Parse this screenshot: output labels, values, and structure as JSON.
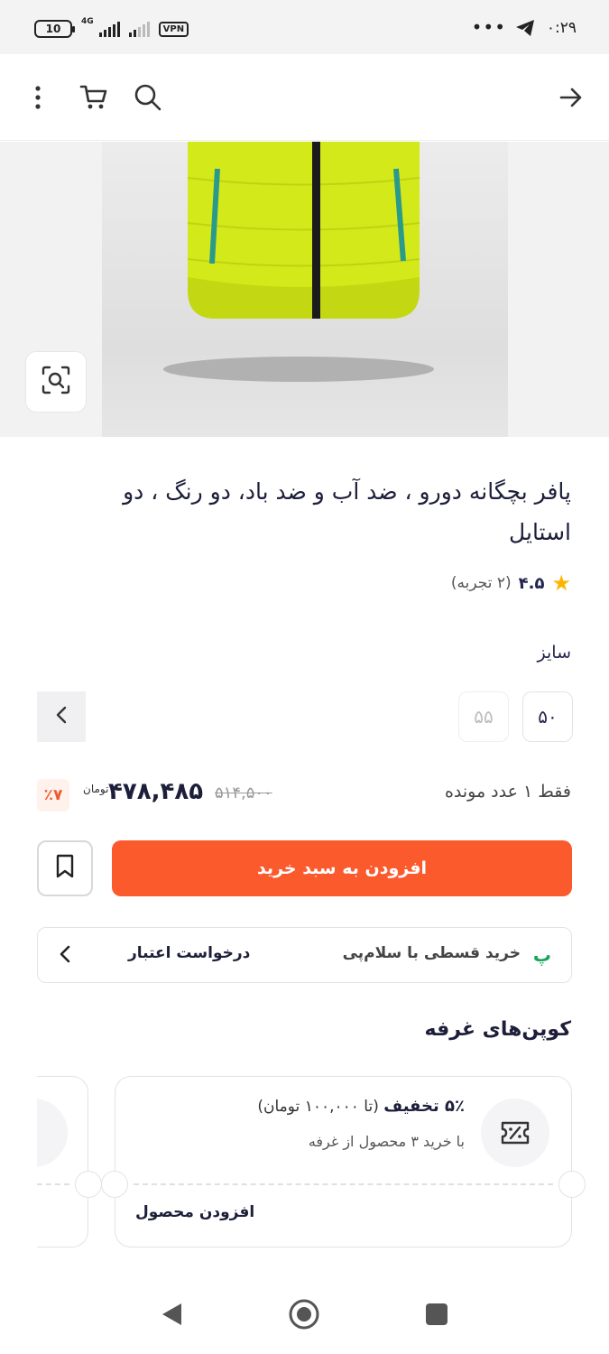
{
  "status_bar": {
    "time": "۰:۲۹",
    "battery": "10",
    "network": "4G",
    "vpn": "VPN",
    "more": "•••"
  },
  "app_bar": {
    "icons": [
      "back-arrow-icon",
      "search-icon",
      "cart-icon",
      "more-vertical-icon"
    ]
  },
  "product": {
    "title": "پافر بچگانه دورو ، ضد آب و ضد باد، دو رنگ ، دو استایل",
    "rating": {
      "value": "۴.۵",
      "count": "(۲ تجربه)"
    },
    "size_label": "سایز",
    "sizes": [
      {
        "label": "۵۰",
        "available": true
      },
      {
        "label": "۵۵",
        "available": false
      }
    ],
    "stock_text": "فقط ۱ عدد مونده",
    "price": "۴۷۸,۴۸۵",
    "old_price": "۵۱۴,۵۰۰",
    "currency": "تومان",
    "discount": "٪۷"
  },
  "actions": {
    "add_to_cart": "افزودن به سبد خرید"
  },
  "credit": {
    "label": "خرید قسطی با سلام‌پی",
    "request": "درخواست اعتبار",
    "logo": "پ"
  },
  "coupons": {
    "title": "کوپن‌های غرفه",
    "items": [
      {
        "discount": "۵٪ تخفیف",
        "limit": "(تا ۱۰۰,۰۰۰ تومان)",
        "condition": "با خرید ۳ محصول از غرفه",
        "action": "افزودن محصول"
      }
    ]
  },
  "colors": {
    "accent": "#fb5a2d",
    "text_primary": "#1d1f3a",
    "star": "#ffb400",
    "discount_bg": "#fff1ec",
    "credit_logo": "#1aa35a"
  }
}
